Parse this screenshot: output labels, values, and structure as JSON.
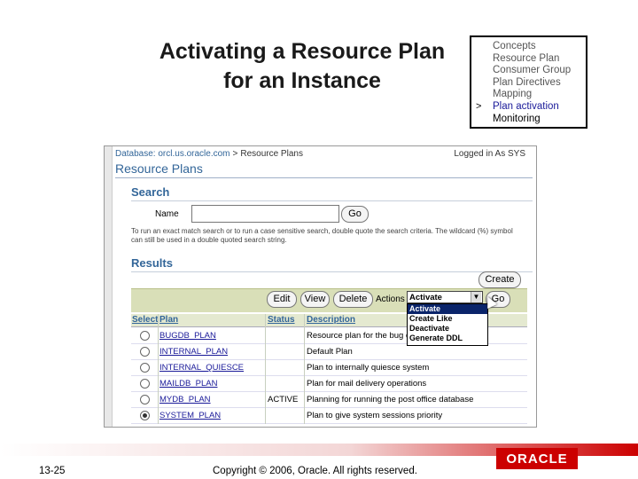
{
  "slide": {
    "title_line1": "Activating a Resource Plan",
    "title_line2": "for an Instance",
    "page_number": "13-25",
    "copyright": "Copyright © 2006, Oracle. All rights reserved.",
    "logo_text": "ORACLE"
  },
  "toc": {
    "marker": ">",
    "items": [
      {
        "label": "Concepts"
      },
      {
        "label": "Resource Plan"
      },
      {
        "label": "Consumer Group"
      },
      {
        "label": "Plan Directives"
      },
      {
        "label": "Mapping"
      },
      {
        "label": "Plan activation"
      },
      {
        "label": "Monitoring"
      }
    ]
  },
  "screenshot": {
    "breadcrumb_db": "Database: orcl.us.oracle.com",
    "breadcrumb_sep": ">",
    "breadcrumb_page": "Resource Plans",
    "logged_in": "Logged in As SYS",
    "page_title": "Resource Plans",
    "search_heading": "Search",
    "name_label": "Name",
    "go_label": "Go",
    "hint": "To run an exact match search or to run a case sensitive search, double quote the search criteria. The wildcard (%) symbol can still be used in a double quoted search string.",
    "results_heading": "Results",
    "create_label": "Create",
    "edit_label": "Edit",
    "view_label": "View",
    "delete_label": "Delete",
    "actions_label": "Actions",
    "actions_selected": "Activate",
    "actions_arrow": "▼",
    "go2_label": "Go",
    "dropdown_options": [
      "Activate",
      "Create Like",
      "Deactivate",
      "Generate DDL"
    ],
    "columns": [
      "Select",
      "Plan",
      "Status",
      "Description"
    ],
    "rows": [
      {
        "plan": "BUGDB_PLAN",
        "status": "",
        "description": "Resource plan for the bug database",
        "selected": false
      },
      {
        "plan": "INTERNAL_PLAN",
        "status": "",
        "description": "Default Plan",
        "selected": false
      },
      {
        "plan": "INTERNAL_QUIESCE",
        "status": "",
        "description": "Plan to internally quiesce system",
        "selected": false
      },
      {
        "plan": "MAILDB_PLAN",
        "status": "",
        "description": "Plan for mail delivery operations",
        "selected": false
      },
      {
        "plan": "MYDB_PLAN",
        "status": "ACTIVE",
        "description": "Planning for running the post office database",
        "selected": false
      },
      {
        "plan": "SYSTEM_PLAN",
        "status": "",
        "description": "Plan to give system sessions priority",
        "selected": true
      }
    ]
  },
  "colors": {
    "title_blue": "#336699",
    "toolbar": "#d9dfb8",
    "oracle_red": "#cc0000",
    "link_blue": "#1a1a99"
  }
}
